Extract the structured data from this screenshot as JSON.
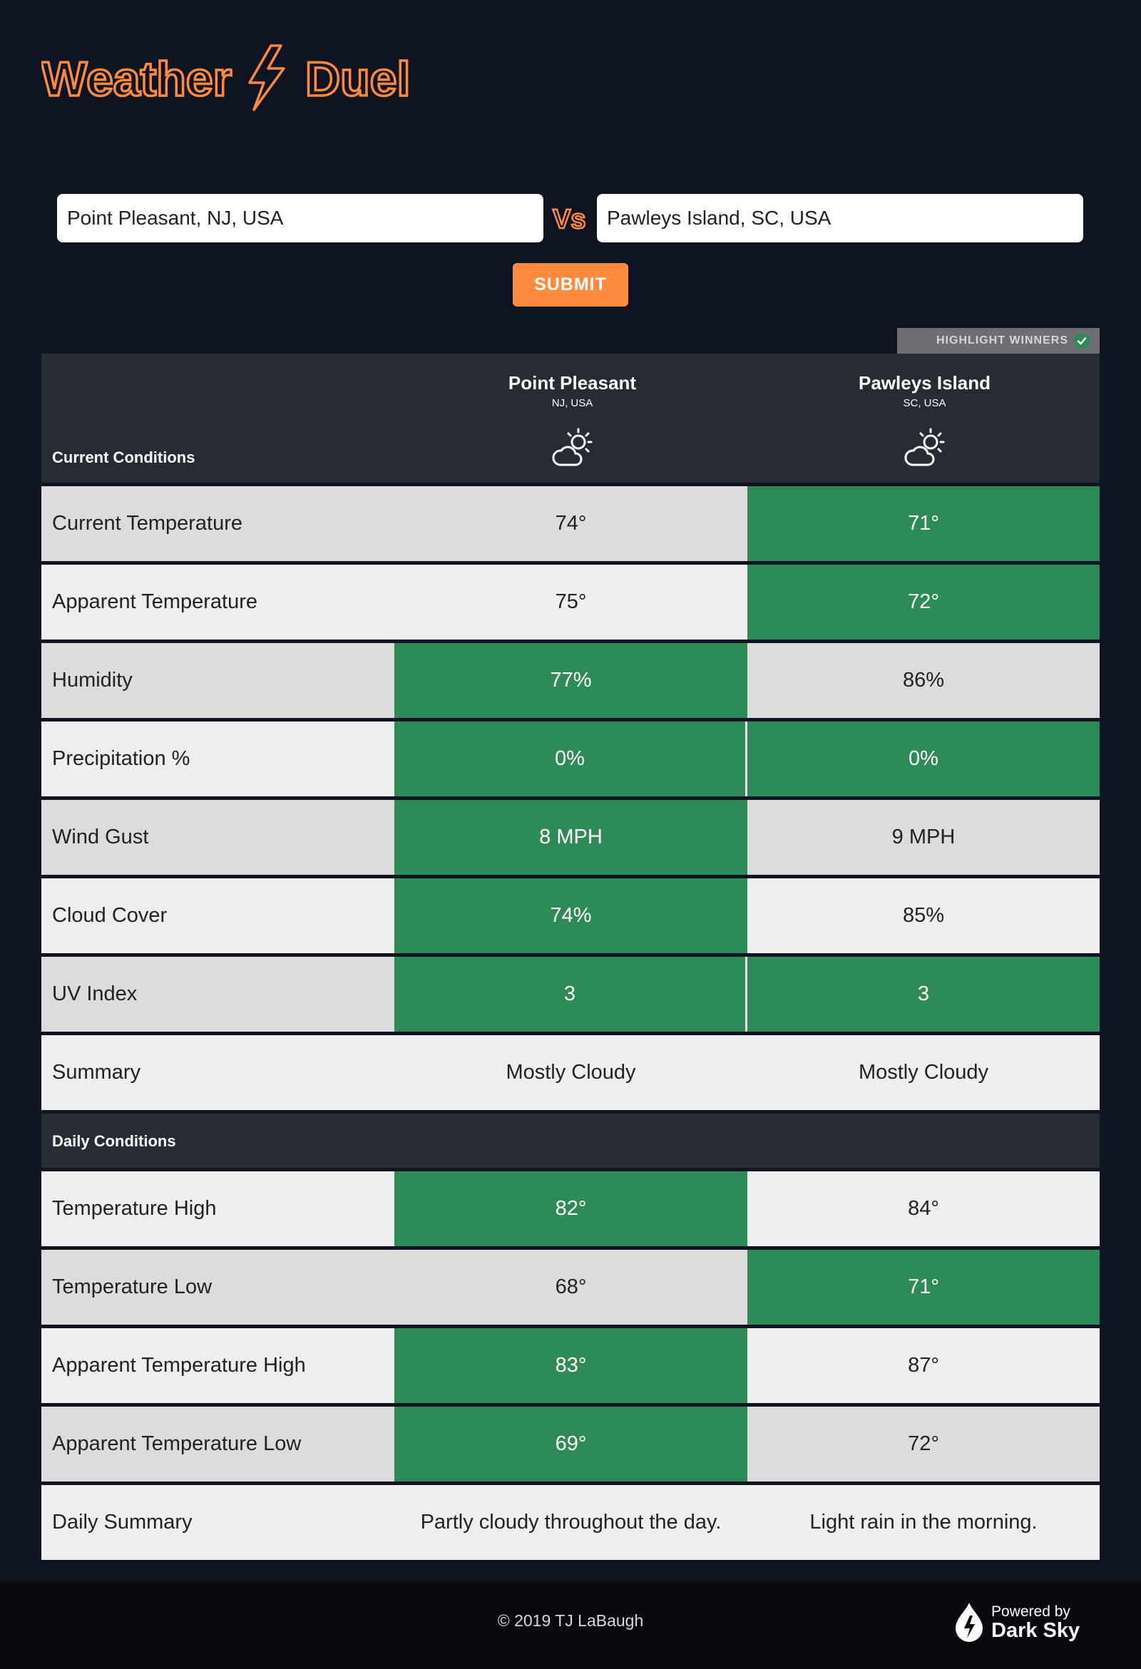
{
  "brand": {
    "name_left": "Weather",
    "name_right": "Duel",
    "accent": "#ff8a3d"
  },
  "form": {
    "location1": "Point Pleasant, NJ, USA",
    "location2": "Pawleys Island, SC, USA",
    "vs_label": "Vs",
    "submit_label": "SUBMIT"
  },
  "highlight_toggle": {
    "label": "HIGHLIGHT WINNERS",
    "checked": true,
    "icon": "check-circle-icon"
  },
  "columns": [
    {
      "name": "Point Pleasant",
      "region": "NJ, USA",
      "icon": "partly-cloudy-day-icon"
    },
    {
      "name": "Pawleys Island",
      "region": "SC, USA",
      "icon": "partly-cloudy-day-icon"
    }
  ],
  "current": {
    "section_label": "Current Conditions",
    "rows": [
      {
        "label": "Current Temperature",
        "v1": "74°",
        "v2": "71°"
      },
      {
        "label": "Apparent Temperature",
        "v1": "75°",
        "v2": "72°"
      },
      {
        "label": "Humidity",
        "v1": "77%",
        "v2": "86%"
      },
      {
        "label": "Precipitation %",
        "v1": "0%",
        "v2": "0%"
      },
      {
        "label": "Wind Gust",
        "v1": "8 MPH",
        "v2": "9 MPH"
      },
      {
        "label": "Cloud Cover",
        "v1": "74%",
        "v2": "85%"
      },
      {
        "label": "UV Index",
        "v1": "3",
        "v2": "3"
      },
      {
        "label": "Summary",
        "v1": "Mostly Cloudy",
        "v2": "Mostly Cloudy"
      }
    ]
  },
  "daily": {
    "section_label": "Daily Conditions",
    "rows": [
      {
        "label": "Temperature High",
        "v1": "82°",
        "v2": "84°"
      },
      {
        "label": "Temperature Low",
        "v1": "68°",
        "v2": "71°"
      },
      {
        "label": "Apparent Temperature High",
        "v1": "83°",
        "v2": "87°"
      },
      {
        "label": "Apparent Temperature Low",
        "v1": "69°",
        "v2": "72°"
      },
      {
        "label": "Daily Summary",
        "v1": "Partly cloudy throughout the day.",
        "v2": "Light rain in the morning."
      }
    ]
  },
  "colors": {
    "winner": "#2e8b57",
    "header_bg": "#272b34",
    "page_bg": "#0e1421"
  },
  "footer": {
    "copyright": "© 2019 TJ LaBaugh",
    "powered_small": "Powered by",
    "powered_big": "Dark Sky"
  }
}
